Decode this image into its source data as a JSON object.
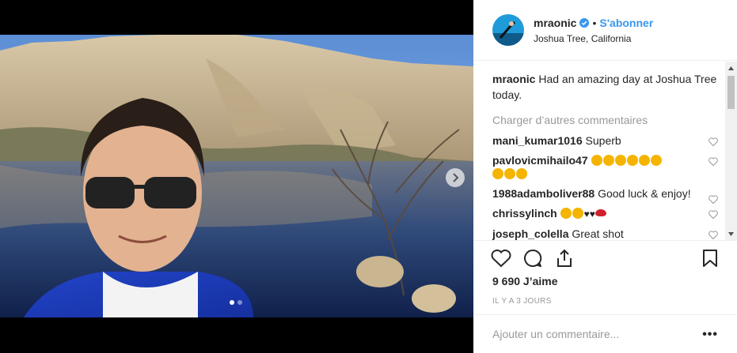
{
  "post": {
    "username": "mraonic",
    "follow_label": "S'abonner",
    "separator": "•",
    "location": "Joshua Tree, California"
  },
  "caption": {
    "username": "mraonic",
    "text": "Had an amazing day at Joshua Tree today."
  },
  "load_more_label": "Charger d’autres commentaires",
  "comments": [
    {
      "username": "mani_kumar1016",
      "text": "Superb"
    },
    {
      "username": "pavlovicmihailo47",
      "text": "",
      "emoji": "clapping-hands ×9"
    },
    {
      "username": "1988adamboliver88",
      "text": "Good luck & enjoy!"
    },
    {
      "username": "chrissylinch",
      "text": "",
      "emoji": "star-struck ×2, black hearts ×2, lips"
    },
    {
      "username": "joseph_colella",
      "text": "Great shot"
    }
  ],
  "likes_label": "9 690 J’aime",
  "date_label": "IL Y A 3 JOURS",
  "add_comment_placeholder": "Ajouter un commentaire...",
  "more_label": "•••",
  "hearts_text": "♥♥",
  "colors": {
    "accent": "#3897f0",
    "text": "#262626",
    "muted": "#999999",
    "border": "#efefef"
  },
  "icons": [
    "verified-badge-icon",
    "heart-icon",
    "comment-icon",
    "share-icon",
    "bookmark-icon",
    "chevron-right-icon"
  ]
}
